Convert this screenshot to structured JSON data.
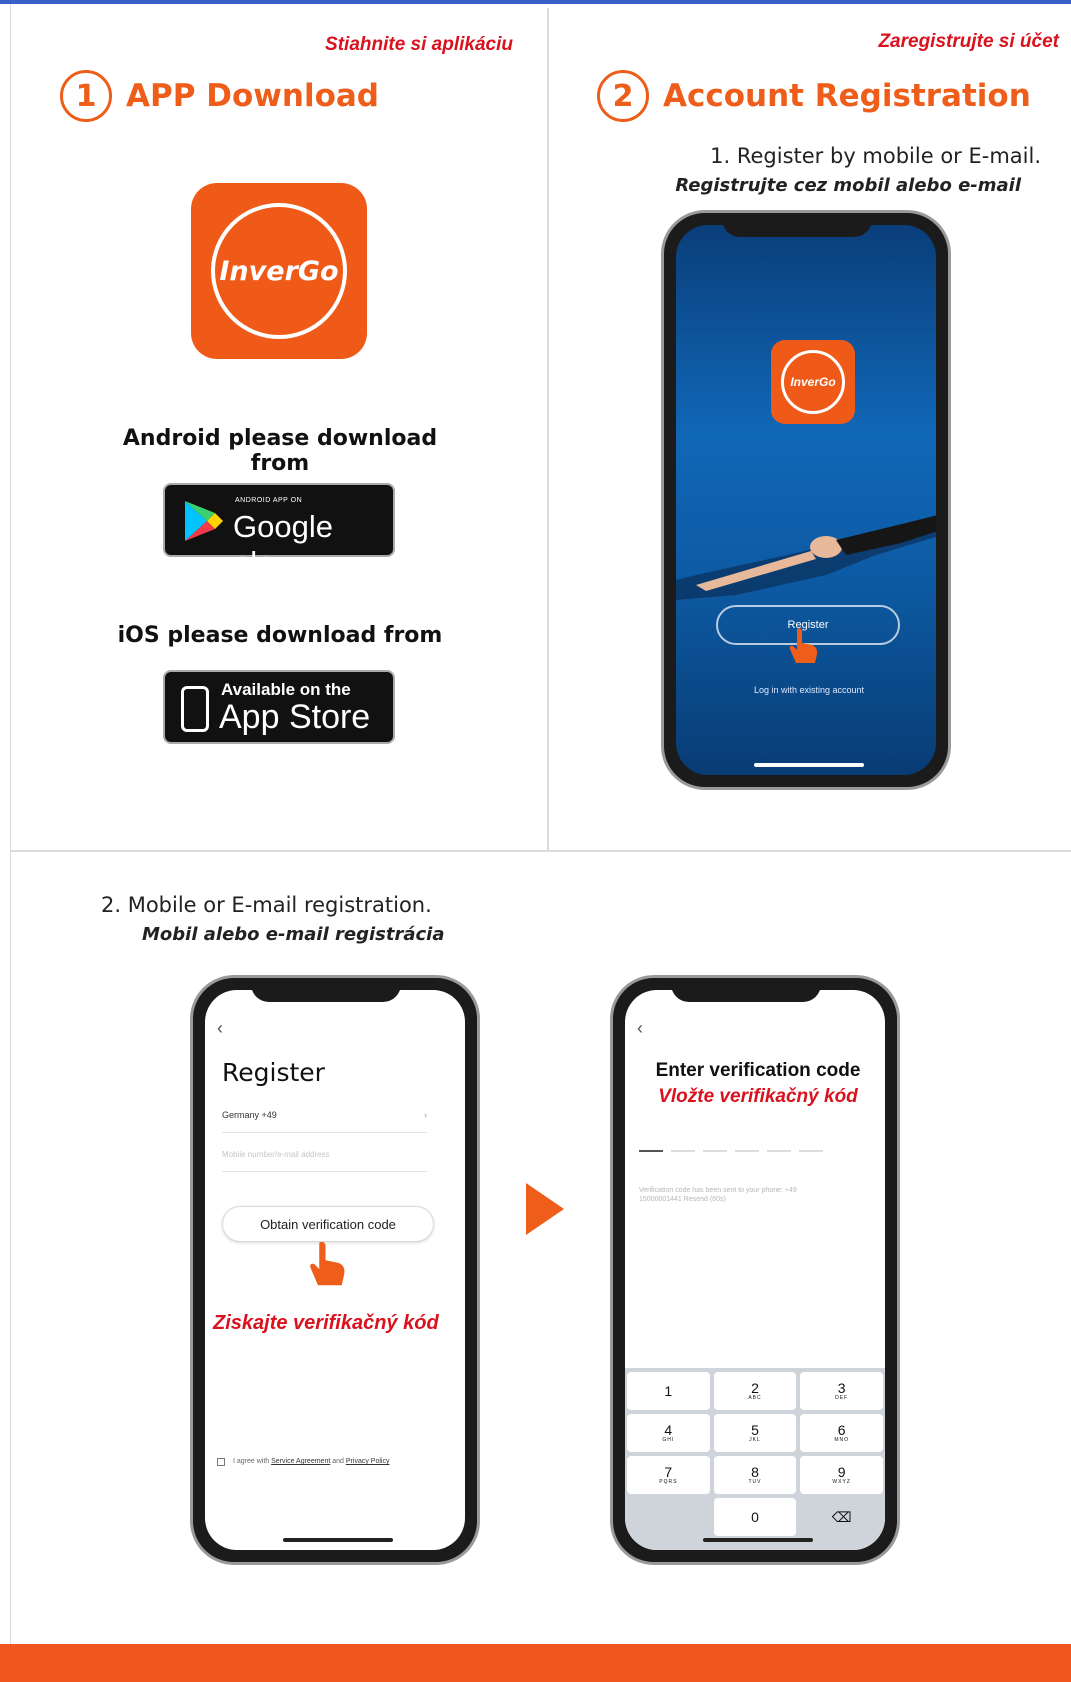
{
  "colors": {
    "accent": "#ee5d1a",
    "red_text": "#d9121e",
    "footer": "#f0561e"
  },
  "step1": {
    "number": "1",
    "title": "APP Download",
    "subtitle_sk": "Stiahnite si aplikáciu",
    "app_name": "InverGo",
    "android_label": "Android please download from",
    "google_play_small": "ANDROID APP ON",
    "google_play_big": "Google play",
    "ios_label": "iOS please download from",
    "app_store_small": "Available on the",
    "app_store_big": "App Store"
  },
  "step2": {
    "number": "2",
    "title": "Account Registration",
    "subtitle_sk": "Zaregistrujte si účet",
    "instruction1": "1. Register by mobile or E-mail.",
    "instruction1_sk": "Registrujte cez mobil alebo e-mail",
    "phone_app_name": "InverGo",
    "register_button": "Register",
    "login_link": "Log in with existing account"
  },
  "step2b": {
    "instruction2": "2. Mobile or E-mail registration.",
    "instruction2_sk": "Mobil alebo e-mail registrácia",
    "back": "‹",
    "register_title": "Register",
    "country": "Germany +49",
    "country_chevron": "›",
    "phone_placeholder": "Mobile number/e-mail address",
    "obtain_button": "Obtain verification code",
    "obtain_sk": "Ziskajte verifikačný kód",
    "agree_text": "I agree with",
    "service_agreement": "Service Agreement",
    "and": "and",
    "privacy_policy": "Privacy Policy",
    "verify_title": "Enter verification code",
    "verify_title_sk": "Vložte verifikačný kód",
    "verify_note": "Verification code has been sent to your phone: +49 15000001441 Resend (60s)",
    "keypad": [
      {
        "d": "1",
        "l": ""
      },
      {
        "d": "2",
        "l": "ABC"
      },
      {
        "d": "3",
        "l": "DEF"
      },
      {
        "d": "4",
        "l": "GHI"
      },
      {
        "d": "5",
        "l": "JKL"
      },
      {
        "d": "6",
        "l": "MNO"
      },
      {
        "d": "7",
        "l": "PQRS"
      },
      {
        "d": "8",
        "l": "TUV"
      },
      {
        "d": "9",
        "l": "WXYZ"
      },
      {
        "d": "",
        "l": ""
      },
      {
        "d": "0",
        "l": ""
      },
      {
        "d": "⌫",
        "l": ""
      }
    ]
  }
}
